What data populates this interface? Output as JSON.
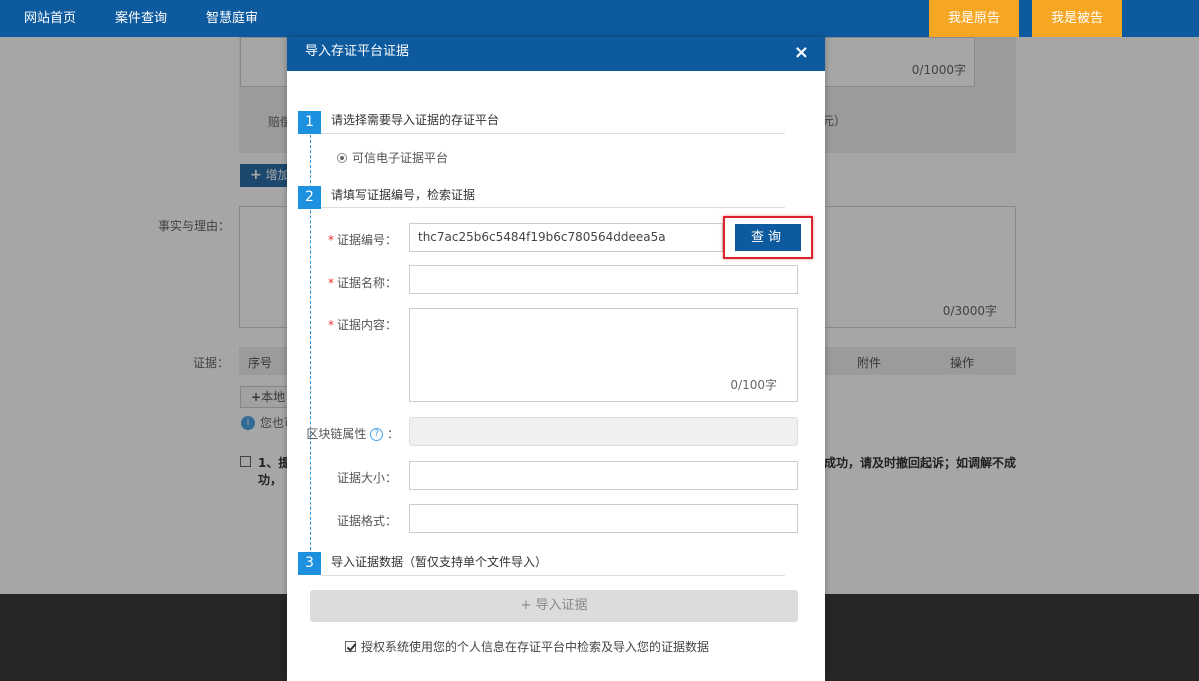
{
  "nav": {
    "home": "网站首页",
    "case_query": "案件查询",
    "smart_court": "智慧庭审",
    "plaintiff": "我是原告",
    "defendant": "我是被告"
  },
  "background": {
    "counter_1000": "0/1000字",
    "compensation_label": "赔偿",
    "yuan_suffix": "元）",
    "add_button": "增加",
    "facts_label": "事实与理由：",
    "counter_3000": "0/3000字",
    "evidence_label": "证据：",
    "table_headers": {
      "seq": "序号",
      "attachment": "附件",
      "operation": "操作"
    },
    "local_upload": "本地",
    "info_text": "您也可",
    "agreement_line1_start": "1、提",
    "agreement_line1_end": "成功，请及时撤回起诉；如调解不成",
    "agreement_line2": "功，"
  },
  "modal": {
    "title": "导入存证平台证据",
    "close": "×",
    "step1": {
      "num": "1",
      "title": "请选择需要导入证据的存证平台",
      "option": "可信电子证据平台"
    },
    "step2": {
      "num": "2",
      "title": "请填写证据编号，检索证据"
    },
    "fields": {
      "evidence_no_label": "证据编号：",
      "evidence_no_value": "thc7ac25b6c5484f19b6c780564ddeea5a",
      "query_button": "查询",
      "evidence_name_label": "证据名称：",
      "evidence_content_label": "证据内容：",
      "content_counter": "0/100字",
      "blockchain_label": "区块链属性",
      "help": "?",
      "colon": "：",
      "size_label": "证据大小：",
      "format_label": "证据格式："
    },
    "step3": {
      "num": "3",
      "title": "导入证据数据（暂仅支持单个文件导入）"
    },
    "import_button": "+ 导入证据",
    "auth_text": "授权系统使用您的个人信息在存证平台中检索及导入您的证据数据"
  }
}
